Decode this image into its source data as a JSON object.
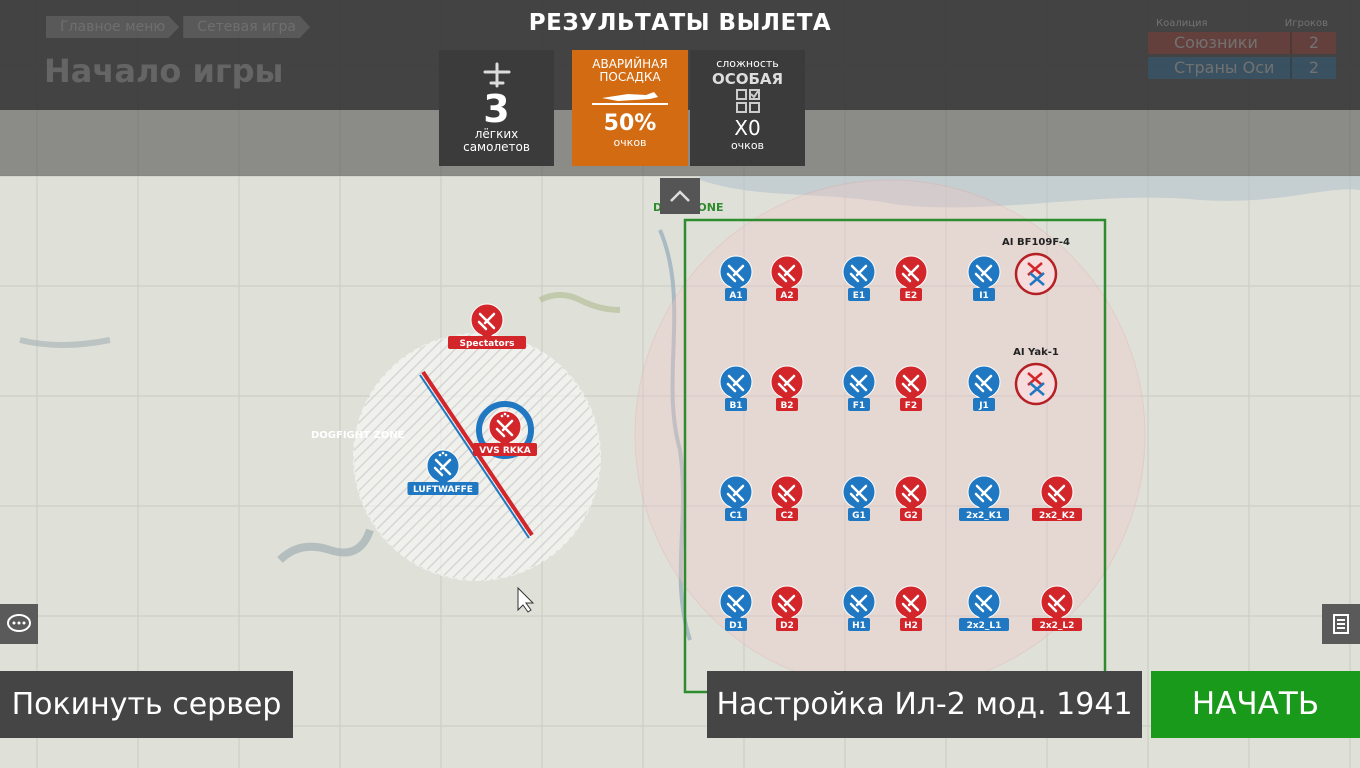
{
  "breadcrumb": {
    "items": [
      "Главное меню",
      "Сетевая игра"
    ]
  },
  "page_title": "Начало игры",
  "results": {
    "title": "РЕЗУЛЬТАТЫ ВЫЛЕТА",
    "planes": {
      "count": "3",
      "label1": "лёгких",
      "label2": "самолетов"
    },
    "landing": {
      "label1": "АВАРИЙНАЯ",
      "label2": "ПОСАДКА",
      "percent": "50%",
      "unit": "очков"
    },
    "difficulty": {
      "label": "сложность",
      "value": "ОСОБАЯ",
      "multiplier": "X0",
      "unit": "очков"
    }
  },
  "team_table": {
    "col_team": "Коалиция",
    "col_players": "Игроков",
    "rows": [
      {
        "name": "Союзники",
        "count": "2",
        "color": "#c0392b"
      },
      {
        "name": "Страны Оси",
        "count": "2",
        "color": "#2980b9"
      }
    ]
  },
  "zones": {
    "duel": "DUEL ZONE",
    "dogfight": "DOGFIGHT ZONE"
  },
  "markers": {
    "spectators": "Spectators",
    "vvs": "VVS RKKA",
    "luftwaffe": "LUFTWAFFE",
    "ai_bf": "AI BF109F-4",
    "ai_yak": "AI Yak-1"
  },
  "duel_slots": [
    [
      "A1",
      "A2",
      "E1",
      "E2",
      "I1"
    ],
    [
      "B1",
      "B2",
      "F1",
      "F2",
      "J1"
    ],
    [
      "C1",
      "C2",
      "G1",
      "G2",
      "2x2_K1",
      "2x2_K2"
    ],
    [
      "D1",
      "D2",
      "H1",
      "H2",
      "2x2_L1",
      "2x2_L2"
    ]
  ],
  "colors": {
    "blue": "#1f78c1",
    "red": "#d3262b",
    "green": "#2e8b2e",
    "orange": "#d36b12"
  },
  "buttons": {
    "leave": "Покинуть сервер",
    "setup": "Настройка Ил-2 мод. 1941",
    "start": "НАЧАТЬ"
  },
  "icons": {
    "chat": "chat-icon",
    "list": "list-icon",
    "collapse": "chevron-up-icon"
  }
}
